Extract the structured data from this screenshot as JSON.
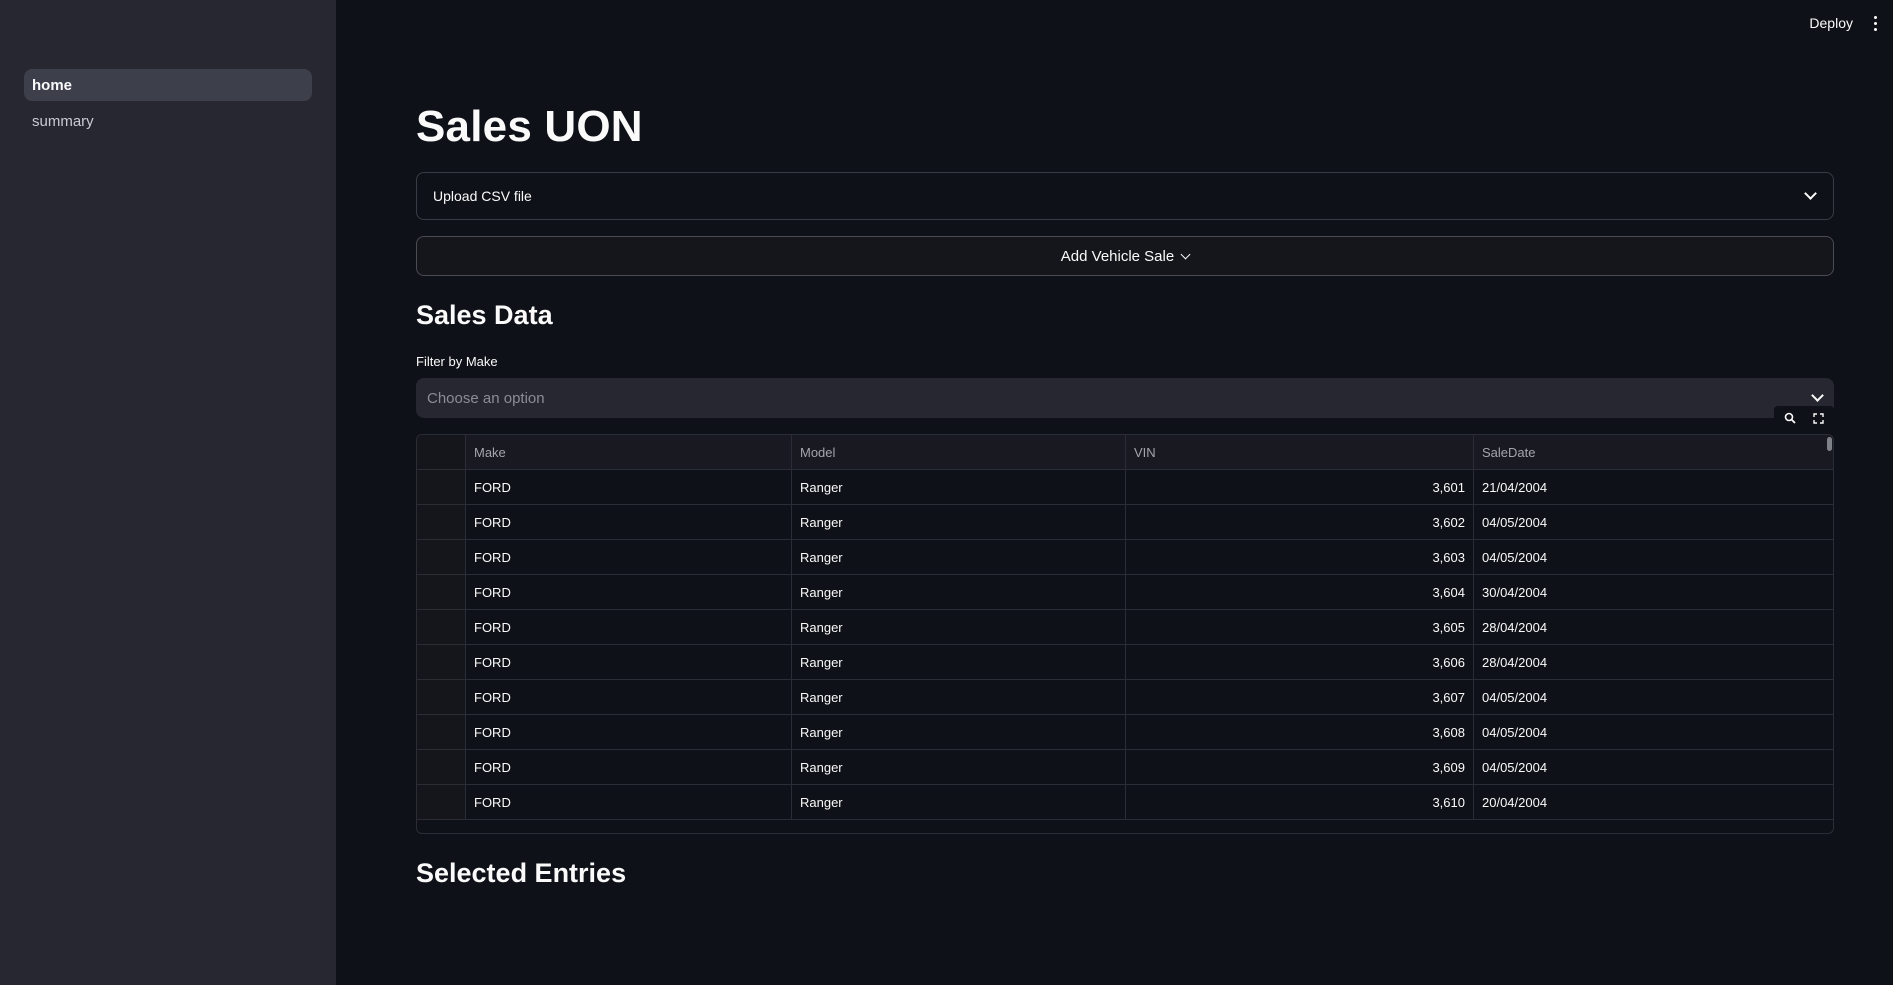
{
  "sidebar": {
    "items": [
      {
        "label": "home",
        "active": true
      },
      {
        "label": "summary",
        "active": false
      }
    ]
  },
  "topbar": {
    "deploy_label": "Deploy",
    "menu_icon": "kebab-menu-icon"
  },
  "main": {
    "title": "Sales UON",
    "upload_expander": {
      "label": "Upload CSV file",
      "icon": "chevron-down-icon"
    },
    "add_button": {
      "label": "Add Vehicle Sale",
      "icon": "chevron-down-icon"
    },
    "sales_heading": "Sales Data",
    "filter": {
      "label": "Filter by Make",
      "placeholder": "Choose an option",
      "icon": "chevron-down-icon"
    },
    "table_tools": {
      "search_icon": "search-icon",
      "fullscreen_icon": "fullscreen-icon"
    },
    "table": {
      "columns": [
        "Make",
        "Model",
        "VIN",
        "SaleDate"
      ],
      "rows": [
        [
          "FORD",
          "Ranger",
          "3,601",
          "21/04/2004"
        ],
        [
          "FORD",
          "Ranger",
          "3,602",
          "04/05/2004"
        ],
        [
          "FORD",
          "Ranger",
          "3,603",
          "04/05/2004"
        ],
        [
          "FORD",
          "Ranger",
          "3,604",
          "30/04/2004"
        ],
        [
          "FORD",
          "Ranger",
          "3,605",
          "28/04/2004"
        ],
        [
          "FORD",
          "Ranger",
          "3,606",
          "28/04/2004"
        ],
        [
          "FORD",
          "Ranger",
          "3,607",
          "04/05/2004"
        ],
        [
          "FORD",
          "Ranger",
          "3,608",
          "04/05/2004"
        ],
        [
          "FORD",
          "Ranger",
          "3,609",
          "04/05/2004"
        ],
        [
          "FORD",
          "Ranger",
          "3,610",
          "20/04/2004"
        ]
      ]
    },
    "selected_heading": "Selected Entries"
  },
  "colors": {
    "background": "#0e1117",
    "sidebar": "#262730",
    "text": "#fafafa"
  }
}
